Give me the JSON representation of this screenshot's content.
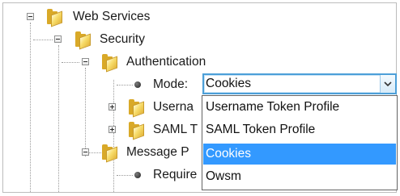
{
  "tree": {
    "web_services": "Web Services",
    "security": "Security",
    "authentication": "Authentication",
    "mode_label": "Mode:",
    "username_partial": "Userna",
    "saml_partial": "SAML T",
    "message_partial": "Message P",
    "require_partial": "Require"
  },
  "mode_select": {
    "value": "Cookies",
    "options": [
      "Username Token Profile",
      "SAML Token Profile",
      "Cookies",
      "Owsm"
    ],
    "selected": "Cookies"
  },
  "colors": {
    "selection": "#3399ff",
    "focus_border": "#4c9fd8",
    "folder": "#f7dc6a"
  }
}
